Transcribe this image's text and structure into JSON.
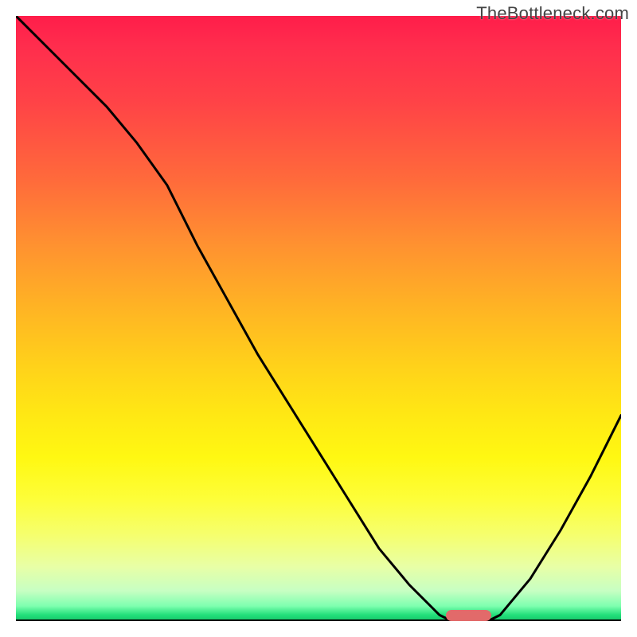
{
  "watermark": "TheBottleneck.com",
  "chart_data": {
    "type": "line",
    "title": "",
    "xlabel": "",
    "ylabel": "",
    "x": [
      0.0,
      0.05,
      0.1,
      0.15,
      0.2,
      0.25,
      0.3,
      0.35,
      0.4,
      0.45,
      0.5,
      0.55,
      0.6,
      0.65,
      0.7,
      0.72,
      0.75,
      0.78,
      0.8,
      0.85,
      0.9,
      0.95,
      1.0
    ],
    "y": [
      1.0,
      0.95,
      0.9,
      0.85,
      0.79,
      0.72,
      0.62,
      0.53,
      0.44,
      0.36,
      0.28,
      0.2,
      0.12,
      0.06,
      0.01,
      0.0,
      0.0,
      0.0,
      0.01,
      0.07,
      0.15,
      0.24,
      0.34
    ],
    "optimal_marker": {
      "x_center": 0.748,
      "width_frac": 0.076,
      "y": 0.009
    },
    "xlim": [
      0,
      1
    ],
    "ylim": [
      0,
      1
    ],
    "grid": false,
    "legend": false,
    "colors": {
      "curve": "#000000",
      "marker": "#e26a6a",
      "gradient_top": "#ff1d4a",
      "gradient_bottom": "#17c569"
    }
  }
}
